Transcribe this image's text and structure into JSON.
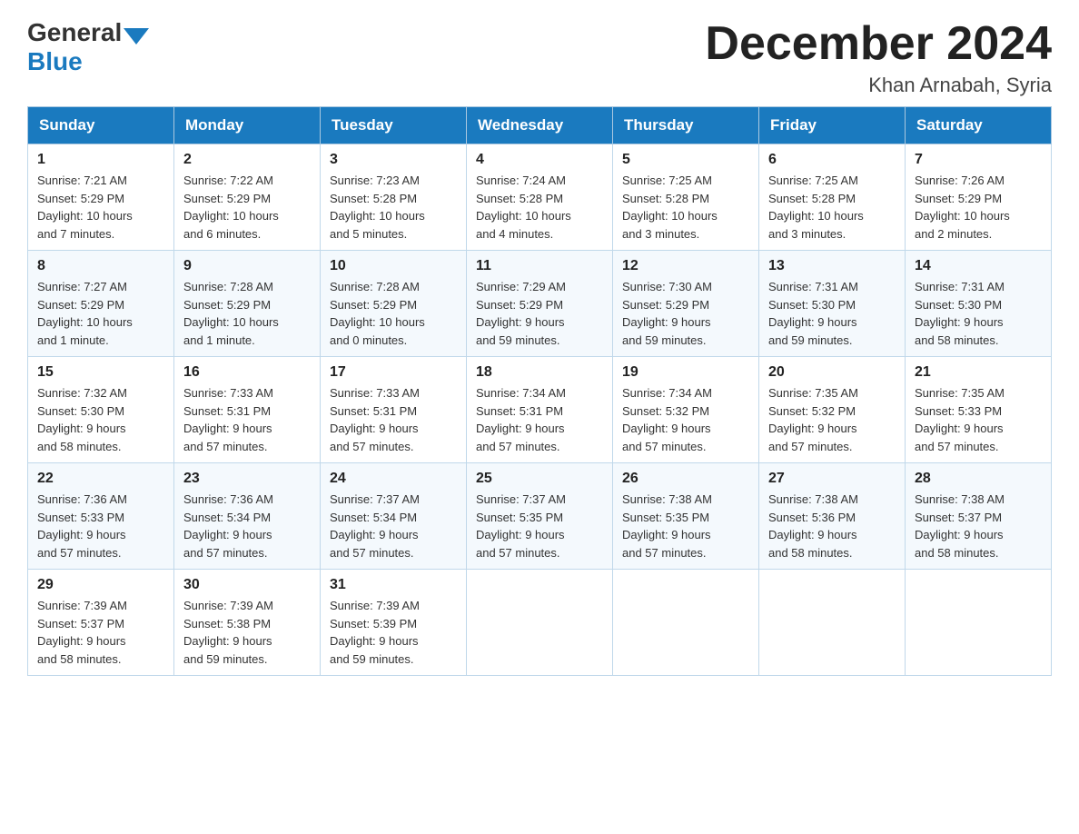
{
  "header": {
    "logo_general": "General",
    "logo_blue": "Blue",
    "month_title": "December 2024",
    "location": "Khan Arnabah, Syria"
  },
  "days_of_week": [
    "Sunday",
    "Monday",
    "Tuesday",
    "Wednesday",
    "Thursday",
    "Friday",
    "Saturday"
  ],
  "weeks": [
    [
      {
        "day": "1",
        "sunrise": "7:21 AM",
        "sunset": "5:29 PM",
        "daylight": "10 hours and 7 minutes."
      },
      {
        "day": "2",
        "sunrise": "7:22 AM",
        "sunset": "5:29 PM",
        "daylight": "10 hours and 6 minutes."
      },
      {
        "day": "3",
        "sunrise": "7:23 AM",
        "sunset": "5:28 PM",
        "daylight": "10 hours and 5 minutes."
      },
      {
        "day": "4",
        "sunrise": "7:24 AM",
        "sunset": "5:28 PM",
        "daylight": "10 hours and 4 minutes."
      },
      {
        "day": "5",
        "sunrise": "7:25 AM",
        "sunset": "5:28 PM",
        "daylight": "10 hours and 3 minutes."
      },
      {
        "day": "6",
        "sunrise": "7:25 AM",
        "sunset": "5:28 PM",
        "daylight": "10 hours and 3 minutes."
      },
      {
        "day": "7",
        "sunrise": "7:26 AM",
        "sunset": "5:29 PM",
        "daylight": "10 hours and 2 minutes."
      }
    ],
    [
      {
        "day": "8",
        "sunrise": "7:27 AM",
        "sunset": "5:29 PM",
        "daylight": "10 hours and 1 minute."
      },
      {
        "day": "9",
        "sunrise": "7:28 AM",
        "sunset": "5:29 PM",
        "daylight": "10 hours and 1 minute."
      },
      {
        "day": "10",
        "sunrise": "7:28 AM",
        "sunset": "5:29 PM",
        "daylight": "10 hours and 0 minutes."
      },
      {
        "day": "11",
        "sunrise": "7:29 AM",
        "sunset": "5:29 PM",
        "daylight": "9 hours and 59 minutes."
      },
      {
        "day": "12",
        "sunrise": "7:30 AM",
        "sunset": "5:29 PM",
        "daylight": "9 hours and 59 minutes."
      },
      {
        "day": "13",
        "sunrise": "7:31 AM",
        "sunset": "5:30 PM",
        "daylight": "9 hours and 59 minutes."
      },
      {
        "day": "14",
        "sunrise": "7:31 AM",
        "sunset": "5:30 PM",
        "daylight": "9 hours and 58 minutes."
      }
    ],
    [
      {
        "day": "15",
        "sunrise": "7:32 AM",
        "sunset": "5:30 PM",
        "daylight": "9 hours and 58 minutes."
      },
      {
        "day": "16",
        "sunrise": "7:33 AM",
        "sunset": "5:31 PM",
        "daylight": "9 hours and 57 minutes."
      },
      {
        "day": "17",
        "sunrise": "7:33 AM",
        "sunset": "5:31 PM",
        "daylight": "9 hours and 57 minutes."
      },
      {
        "day": "18",
        "sunrise": "7:34 AM",
        "sunset": "5:31 PM",
        "daylight": "9 hours and 57 minutes."
      },
      {
        "day": "19",
        "sunrise": "7:34 AM",
        "sunset": "5:32 PM",
        "daylight": "9 hours and 57 minutes."
      },
      {
        "day": "20",
        "sunrise": "7:35 AM",
        "sunset": "5:32 PM",
        "daylight": "9 hours and 57 minutes."
      },
      {
        "day": "21",
        "sunrise": "7:35 AM",
        "sunset": "5:33 PM",
        "daylight": "9 hours and 57 minutes."
      }
    ],
    [
      {
        "day": "22",
        "sunrise": "7:36 AM",
        "sunset": "5:33 PM",
        "daylight": "9 hours and 57 minutes."
      },
      {
        "day": "23",
        "sunrise": "7:36 AM",
        "sunset": "5:34 PM",
        "daylight": "9 hours and 57 minutes."
      },
      {
        "day": "24",
        "sunrise": "7:37 AM",
        "sunset": "5:34 PM",
        "daylight": "9 hours and 57 minutes."
      },
      {
        "day": "25",
        "sunrise": "7:37 AM",
        "sunset": "5:35 PM",
        "daylight": "9 hours and 57 minutes."
      },
      {
        "day": "26",
        "sunrise": "7:38 AM",
        "sunset": "5:35 PM",
        "daylight": "9 hours and 57 minutes."
      },
      {
        "day": "27",
        "sunrise": "7:38 AM",
        "sunset": "5:36 PM",
        "daylight": "9 hours and 58 minutes."
      },
      {
        "day": "28",
        "sunrise": "7:38 AM",
        "sunset": "5:37 PM",
        "daylight": "9 hours and 58 minutes."
      }
    ],
    [
      {
        "day": "29",
        "sunrise": "7:39 AM",
        "sunset": "5:37 PM",
        "daylight": "9 hours and 58 minutes."
      },
      {
        "day": "30",
        "sunrise": "7:39 AM",
        "sunset": "5:38 PM",
        "daylight": "9 hours and 59 minutes."
      },
      {
        "day": "31",
        "sunrise": "7:39 AM",
        "sunset": "5:39 PM",
        "daylight": "9 hours and 59 minutes."
      },
      null,
      null,
      null,
      null
    ]
  ],
  "labels": {
    "sunrise": "Sunrise:",
    "sunset": "Sunset:",
    "daylight": "Daylight:"
  }
}
